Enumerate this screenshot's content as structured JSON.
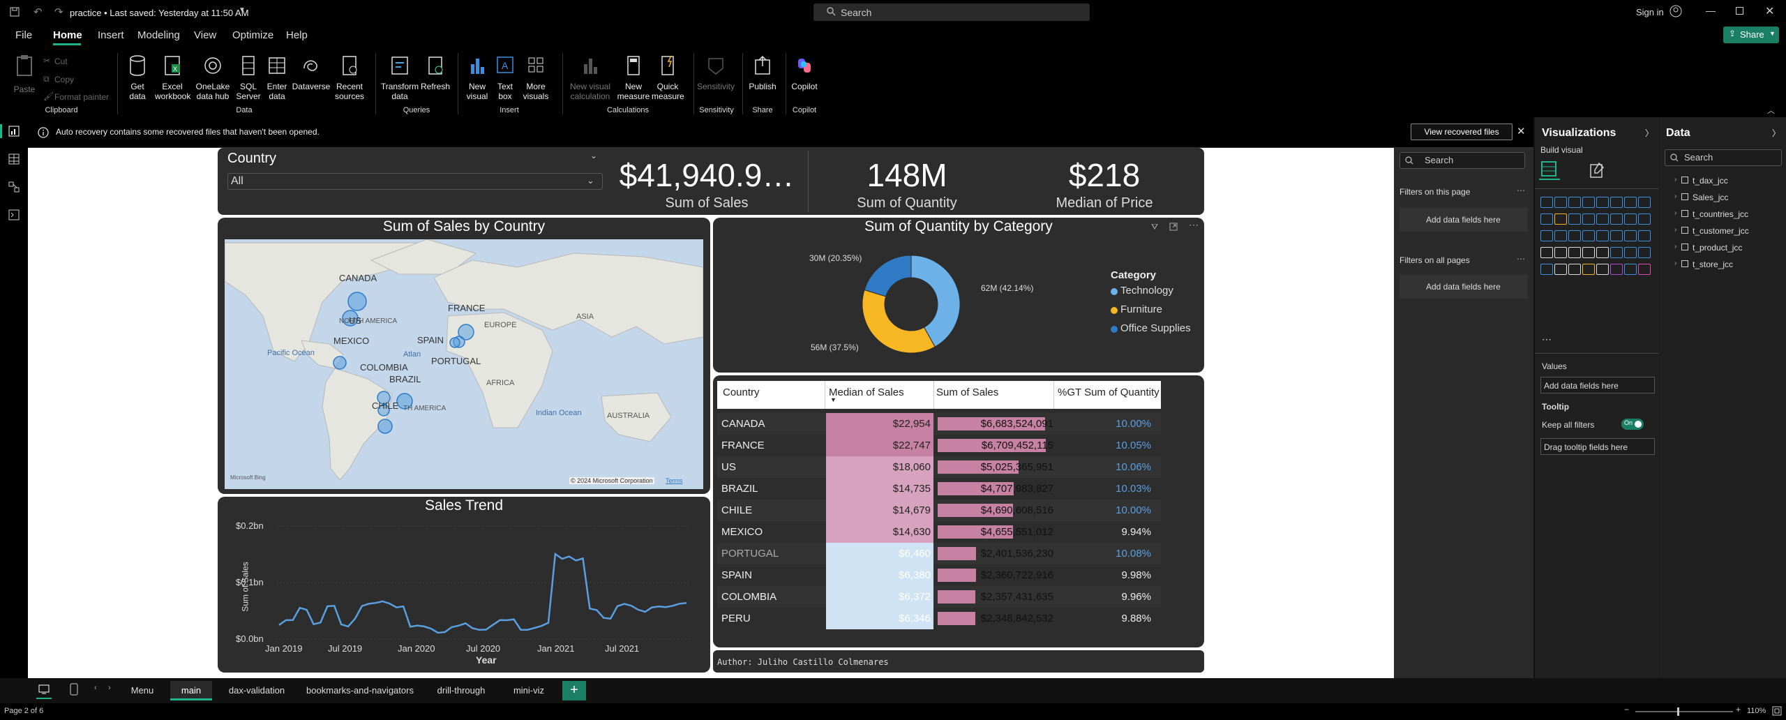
{
  "titlebar": {
    "title": "practice • Last saved: Yesterday at 11:50 AM",
    "search_placeholder": "Search",
    "signin": "Sign in"
  },
  "menu": {
    "items": [
      "File",
      "Home",
      "Insert",
      "Modeling",
      "View",
      "Optimize",
      "Help"
    ],
    "active": "Home",
    "share": "Share"
  },
  "ribbon": {
    "clipboard": {
      "paste": "Paste",
      "cut": "Cut",
      "copy": "Copy",
      "format_painter": "Format painter",
      "group": "Clipboard"
    },
    "data": {
      "get_data": "Get data",
      "excel": "Excel workbook",
      "onelake": "OneLake data hub",
      "sql": "SQL Server",
      "enter": "Enter data",
      "dataverse": "Dataverse",
      "recent": "Recent sources",
      "group": "Data"
    },
    "queries": {
      "transform": "Transform data",
      "refresh": "Refresh",
      "group": "Queries"
    },
    "insert": {
      "new_visual": "New visual",
      "text_box": "Text box",
      "more_visuals": "More visuals",
      "group": "Insert"
    },
    "calculations": {
      "new_visual_calc": "New visual calculation",
      "new_measure": "New measure",
      "quick_measure": "Quick measure",
      "group": "Calculations"
    },
    "sensitivity": {
      "label": "Sensitivity",
      "group": "Sensitivity"
    },
    "share": {
      "publish": "Publish",
      "group": "Share"
    },
    "copilot": {
      "label": "Copilot",
      "group": "Copilot"
    }
  },
  "notification": {
    "message": "Auto recovery contains some recovered files that haven't been opened.",
    "button": "View recovered files"
  },
  "report": {
    "slicer": {
      "title": "Country",
      "value": "All"
    },
    "kpis": [
      {
        "value": "$41,940.9…",
        "label": "Sum of Sales"
      },
      {
        "value": "148M",
        "label": "Sum of Quantity"
      },
      {
        "value": "$218",
        "label": "Median of Price"
      }
    ],
    "map": {
      "title": "Sum of Sales by Country",
      "labels": [
        "CANADA",
        "US",
        "MEXICO",
        "COLOMBIA",
        "BRAZIL",
        "CHILE",
        "FRANCE",
        "SPAIN",
        "PORTUGAL",
        "EUROPE",
        "ASIA",
        "AFRICA",
        "AUSTRALIA",
        "Pacific Ocean",
        "Indian Ocean",
        "Atlan",
        "NORTH AMERICA",
        "TH AMERICA"
      ],
      "copyright": "© 2024 Microsoft Corporation",
      "terms": "Terms",
      "bing": "Microsoft Bing"
    },
    "donut": {
      "title": "Sum of Quantity by Category",
      "legend_title": "Category",
      "labels": [
        "62M (42.14%)",
        "56M (37.5%)",
        "30M (20.35%)"
      ]
    },
    "table": {
      "columns": [
        "Country",
        "Median of Sales",
        "Sum of Sales",
        "%GT Sum of Quantity"
      ],
      "rows": [
        {
          "country": "CANADA",
          "median": "$22,954",
          "sum": "$6,683,524,091",
          "pct": "10.00%"
        },
        {
          "country": "FRANCE",
          "median": "$22,747",
          "sum": "$6,709,452,115",
          "pct": "10.05%"
        },
        {
          "country": "US",
          "median": "$18,060",
          "sum": "$5,025,365,951",
          "pct": "10.06%"
        },
        {
          "country": "BRAZIL",
          "median": "$14,735",
          "sum": "$4,707,983,827",
          "pct": "10.03%"
        },
        {
          "country": "CHILE",
          "median": "$14,679",
          "sum": "$4,690,608,516",
          "pct": "10.00%"
        },
        {
          "country": "MEXICO",
          "median": "$14,630",
          "sum": "$4,655,551,012",
          "pct": "9.94%"
        },
        {
          "country": "PORTUGAL",
          "median": "$6,460",
          "sum": "$2,401,536,230",
          "pct": "10.08%"
        },
        {
          "country": "SPAIN",
          "median": "$6,380",
          "sum": "$2,360,722,916",
          "pct": "9.98%"
        },
        {
          "country": "COLOMBIA",
          "median": "$6,372",
          "sum": "$2,357,431,635",
          "pct": "9.96%"
        },
        {
          "country": "PERU",
          "median": "$6,346",
          "sum": "$2,348,842,532",
          "pct": "9.88%"
        }
      ]
    },
    "trend": {
      "title": "Sales Trend",
      "xlabel": "Year",
      "ylabel": "Sum of Sales",
      "yticks": [
        "$0.2bn",
        "$0.1bn",
        "$0.0bn"
      ],
      "xticks": [
        "Jan 2019",
        "Jul 2019",
        "Jan 2020",
        "Jul 2020",
        "Jan 2021",
        "Jul 2021"
      ]
    },
    "author": "Author: Juliho Castillo Colmenares"
  },
  "chart_data": [
    {
      "type": "pie",
      "title": "Sum of Quantity by Category",
      "categories": [
        "Technology",
        "Furniture",
        "Office Supplies"
      ],
      "values": [
        62,
        56,
        30
      ],
      "unit": "M",
      "percent": [
        42.14,
        37.5,
        20.35
      ],
      "colors": [
        "#6cb2e8",
        "#f6b723",
        "#2f7bc6"
      ],
      "legend": "right"
    },
    {
      "type": "line",
      "title": "Sales Trend",
      "xlabel": "Year",
      "ylabel": "Sum of Sales",
      "ylim": [
        0,
        0.2
      ],
      "x": [
        "Jan 2019",
        "Mar 2019",
        "Apr 2019",
        "Jun 2019",
        "Jul 2019",
        "Sep 2019",
        "Nov 2019",
        "Jan 2020",
        "Mar 2020",
        "Jul 2020",
        "Sep 2020",
        "Nov 2020",
        "Dec 2020",
        "Jan 2021",
        "Feb 2021",
        "Apr 2021",
        "Jun 2021",
        "Aug 2021",
        "Oct 2021",
        "Dec 2021"
      ],
      "values": [
        0.03,
        0.06,
        0.03,
        0.06,
        0.06,
        0.02,
        0.06,
        0.06,
        0.02,
        0.02,
        0.02,
        0.02,
        0.02,
        0.15,
        0.14,
        0.05,
        0.06,
        0.05,
        0.06,
        0.06
      ]
    },
    {
      "type": "table",
      "columns": [
        "Country",
        "Median of Sales",
        "Sum of Sales",
        "%GT Sum of Quantity"
      ],
      "rows": [
        [
          "CANADA",
          22954,
          6683524091,
          10.0
        ],
        [
          "FRANCE",
          22747,
          6709452115,
          10.05
        ],
        [
          "US",
          18060,
          5025365951,
          10.06
        ],
        [
          "BRAZIL",
          14735,
          4707983827,
          10.03
        ],
        [
          "CHILE",
          14679,
          4690608516,
          10.0
        ],
        [
          "MEXICO",
          14630,
          4655551012,
          9.94
        ],
        [
          "PORTUGAL",
          6460,
          2401536230,
          10.08
        ],
        [
          "SPAIN",
          6380,
          2360722916,
          9.98
        ],
        [
          "COLOMBIA",
          6372,
          2357431635,
          9.96
        ],
        [
          "PERU",
          6346,
          2348842532,
          9.88
        ]
      ]
    }
  ],
  "filters": {
    "search": "Search",
    "on_page": "Filters on this page",
    "on_all": "Filters on all pages",
    "add": "Add data fields here"
  },
  "visualizations": {
    "title": "Visualizations",
    "build": "Build visual",
    "values": "Values",
    "values_add": "Add data fields here",
    "tooltip": "Tooltip",
    "keep_filters": "Keep all filters",
    "toggle": "On",
    "tooltip_drag": "Drag tooltip fields here"
  },
  "data_pane": {
    "title": "Data",
    "search": "Search",
    "tables": [
      "t_dax_jcc",
      "Sales_jcc",
      "t_countries_jcc",
      "t_customer_jcc",
      "t_product_jcc",
      "t_store_jcc"
    ]
  },
  "tabs": {
    "items": [
      "Menu",
      "main",
      "dax-validation",
      "bookmarks-and-navigators",
      "drill-through",
      "mini-viz"
    ],
    "active": "main",
    "add": "+"
  },
  "status": {
    "page": "Page 2 of 6",
    "zoom": "110%"
  }
}
